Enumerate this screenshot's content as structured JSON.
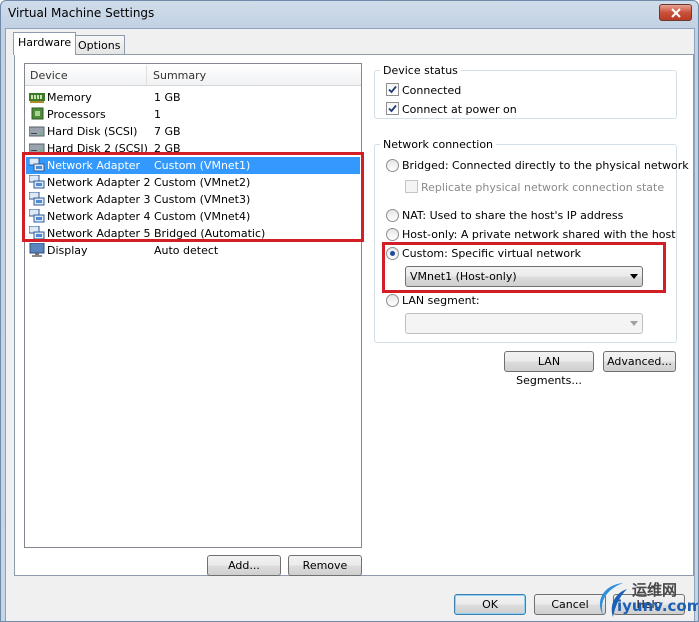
{
  "window": {
    "title": "Virtual Machine Settings"
  },
  "tabs": [
    {
      "label": "Hardware",
      "active": true
    },
    {
      "label": "Options",
      "active": false
    }
  ],
  "device_list": {
    "columns": [
      "Device",
      "Summary"
    ],
    "rows": [
      {
        "device": "Memory",
        "summary": "1 GB",
        "icon": "memory-icon",
        "selected": false
      },
      {
        "device": "Processors",
        "summary": "1",
        "icon": "processor-icon",
        "selected": false
      },
      {
        "device": "Hard Disk (SCSI)",
        "summary": "7 GB",
        "icon": "hard-disk-icon",
        "selected": false
      },
      {
        "device": "Hard Disk 2 (SCSI)",
        "summary": "2 GB",
        "icon": "hard-disk-icon",
        "selected": false
      },
      {
        "device": "Network Adapter",
        "summary": "Custom (VMnet1)",
        "icon": "network-adapter-icon",
        "selected": true
      },
      {
        "device": "Network Adapter 2",
        "summary": "Custom (VMnet2)",
        "icon": "network-adapter-icon",
        "selected": false
      },
      {
        "device": "Network Adapter 3",
        "summary": "Custom (VMnet3)",
        "icon": "network-adapter-icon",
        "selected": false
      },
      {
        "device": "Network Adapter 4",
        "summary": "Custom (VMnet4)",
        "icon": "network-adapter-icon",
        "selected": false
      },
      {
        "device": "Network Adapter 5",
        "summary": "Bridged (Automatic)",
        "icon": "network-adapter-icon",
        "selected": false
      },
      {
        "device": "Display",
        "summary": "Auto detect",
        "icon": "display-icon",
        "selected": false
      }
    ]
  },
  "list_buttons": {
    "add": "Add...",
    "remove": "Remove"
  },
  "device_status": {
    "legend": "Device status",
    "connected": {
      "label": "Connected",
      "checked": true
    },
    "connect_at_power_on": {
      "label": "Connect at power on",
      "checked": true
    }
  },
  "network_connection": {
    "legend": "Network connection",
    "bridged": {
      "label": "Bridged: Connected directly to the physical network",
      "selected": false
    },
    "replicate": {
      "label": "Replicate physical network connection state",
      "checked": false,
      "disabled": true
    },
    "nat": {
      "label": "NAT: Used to share the host's IP address",
      "selected": false
    },
    "host_only": {
      "label": "Host-only: A private network shared with the host",
      "selected": false
    },
    "custom": {
      "label": "Custom: Specific virtual network",
      "selected": true
    },
    "custom_network": {
      "value": "VMnet1 (Host-only)"
    },
    "lan_segment": {
      "label": "LAN segment:",
      "selected": false
    },
    "lan_segment_select": {
      "value": ""
    }
  },
  "panel_buttons": {
    "lan_segments": "LAN Segments...",
    "advanced": "Advanced..."
  },
  "dialog_buttons": {
    "ok": "OK",
    "cancel": "Cancel",
    "help": "Help"
  },
  "watermark": {
    "brand_cn": "运维网",
    "url": "iyunv.com"
  },
  "colors": {
    "selection": "#3399ff",
    "highlight_box": "#d21f26",
    "window_frame": "#c6d5e6"
  }
}
